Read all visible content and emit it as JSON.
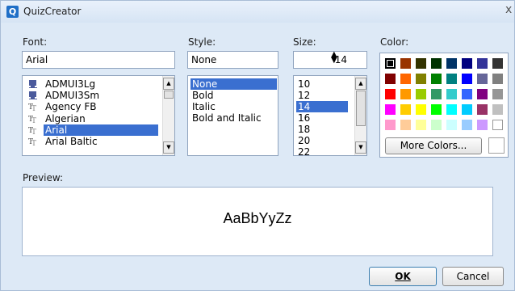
{
  "window": {
    "title": "QuizCreator",
    "close_glyph": "x",
    "app_icon": "Q"
  },
  "font": {
    "label": "Font:",
    "value": "Arial",
    "items": [
      "ADMUI3Lg",
      "ADMUI3Sm",
      "Agency FB",
      "Algerian",
      "Arial",
      "Arial Baltic"
    ],
    "selected": "Arial"
  },
  "style": {
    "label": "Style:",
    "value": "None",
    "items": [
      "None",
      "Bold",
      "Italic",
      "Bold and Italic"
    ],
    "selected": "None"
  },
  "size": {
    "label": "Size:",
    "value": "14",
    "items": [
      "10",
      "12",
      "14",
      "16",
      "18",
      "20",
      "22"
    ],
    "selected": "14"
  },
  "color": {
    "label": "Color:",
    "selected": "#000000",
    "palette": [
      [
        "#000000",
        "#993300",
        "#333300",
        "#003300",
        "#003366",
        "#000080",
        "#333399",
        "#333333"
      ],
      [
        "#800000",
        "#ff6600",
        "#808000",
        "#008000",
        "#008080",
        "#0000ff",
        "#666699",
        "#808080"
      ],
      [
        "#ff0000",
        "#ff9900",
        "#99cc00",
        "#339966",
        "#33cccc",
        "#3366ff",
        "#800080",
        "#969696"
      ],
      [
        "#ff00ff",
        "#ffcc00",
        "#ffff00",
        "#00ff00",
        "#00ffff",
        "#00ccff",
        "#993366",
        "#c0c0c0"
      ],
      [
        "#ff99cc",
        "#ffcc99",
        "#ffff99",
        "#ccffcc",
        "#ccffff",
        "#99ccff",
        "#cc99ff",
        "#ffffff"
      ]
    ],
    "more_label": "More Colors..."
  },
  "preview": {
    "label": "Preview:",
    "sample": "AaBbYyZz"
  },
  "buttons": {
    "ok": "OK",
    "cancel": "Cancel"
  }
}
